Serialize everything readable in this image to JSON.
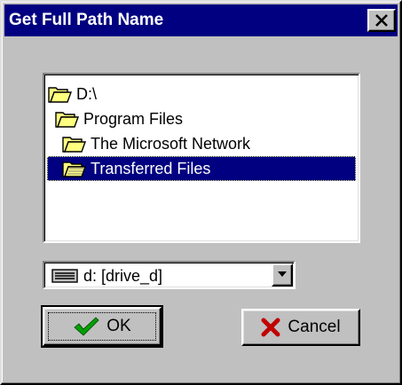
{
  "window": {
    "title": "Get Full Path Name"
  },
  "directory_list": {
    "items": [
      {
        "label": "D:\\",
        "icon": "open-folder-icon",
        "selected": false
      },
      {
        "label": "Program Files",
        "icon": "open-folder-icon",
        "selected": false
      },
      {
        "label": "The Microsoft Network",
        "icon": "open-folder-icon",
        "selected": false
      },
      {
        "label": "Transferred Files",
        "icon": "open-folder-icon",
        "selected": true
      }
    ]
  },
  "drive_combo": {
    "value": "d: [drive_d]",
    "icon": "hard-drive-icon"
  },
  "buttons": {
    "ok_label": "OK",
    "ok_icon": "checkmark-icon",
    "cancel_label": "Cancel",
    "cancel_icon": "x-mark-icon"
  },
  "colors": {
    "title_bar": "#000080",
    "face": "#c0c0c0",
    "selection": "#000080",
    "folder": "#ffff80",
    "check": "#00a000",
    "cancel_x": "#c00000"
  }
}
